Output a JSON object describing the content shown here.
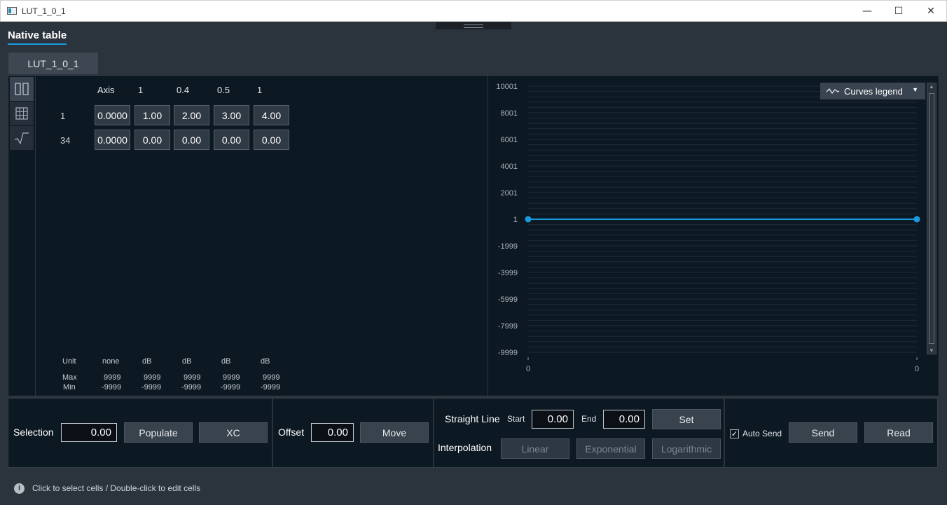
{
  "window": {
    "title": "LUT_1_0_1",
    "minimize": "—",
    "maximize": "☐",
    "close": "✕"
  },
  "header": {
    "title": "Native table"
  },
  "tabs": [
    {
      "label": "LUT_1_0_1"
    }
  ],
  "table": {
    "axis_label": "Axis",
    "columns": [
      "1",
      "0.4",
      "0.5",
      "1"
    ],
    "rows": [
      {
        "label": "1",
        "axis": "0.0000",
        "values": [
          "1.00",
          "2.00",
          "3.00",
          "4.00"
        ]
      },
      {
        "label": "34",
        "axis": "0.0000",
        "values": [
          "0.00",
          "0.00",
          "0.00",
          "0.00"
        ]
      }
    ],
    "unit_label": "Unit",
    "units": [
      "none",
      "dB",
      "dB",
      "dB",
      "dB"
    ],
    "max_label": "Max",
    "max": [
      "9999",
      "9999",
      "9999",
      "9999",
      "9999"
    ],
    "min_label": "Min",
    "min": [
      "-9999",
      "-9999",
      "-9999",
      "-9999",
      "-9999"
    ]
  },
  "chart": {
    "legend_label": "Curves legend",
    "y_ticks": [
      "10001",
      "8001",
      "6001",
      "4001",
      "2001",
      "1",
      "-1999",
      "-3999",
      "-5999",
      "-7999",
      "-9999"
    ],
    "x_ticks": [
      "0",
      "0"
    ],
    "line_color": "#1a9be0"
  },
  "chart_data": {
    "type": "line",
    "ylim": [
      -9999,
      10001
    ],
    "yticks": [
      10001,
      8001,
      6001,
      4001,
      2001,
      1,
      -1999,
      -3999,
      -5999,
      -7999,
      -9999
    ],
    "x_tick_labels": [
      "0",
      "0"
    ],
    "series": [
      {
        "x": [
          0,
          1
        ],
        "values": [
          1,
          1
        ]
      }
    ]
  },
  "controls": {
    "selection_label": "Selection",
    "selection_value": "0.00",
    "populate_label": "Populate",
    "xc_label": "XC",
    "offset_label": "Offset",
    "offset_value": "0.00",
    "move_label": "Move",
    "straight_line_label": "Straight Line",
    "start_label": "Start",
    "start_value": "0.00",
    "end_label": "End",
    "end_value": "0.00",
    "set_label": "Set",
    "interpolation_label": "Interpolation",
    "linear_label": "Linear",
    "exponential_label": "Exponential",
    "logarithmic_label": "Logarithmic",
    "auto_send_label": "Auto Send",
    "auto_send_checked": "✓",
    "send_label": "Send",
    "read_label": "Read"
  },
  "status": {
    "info_icon": "i",
    "text": "Click to select cells / Double-click to edit cells"
  }
}
